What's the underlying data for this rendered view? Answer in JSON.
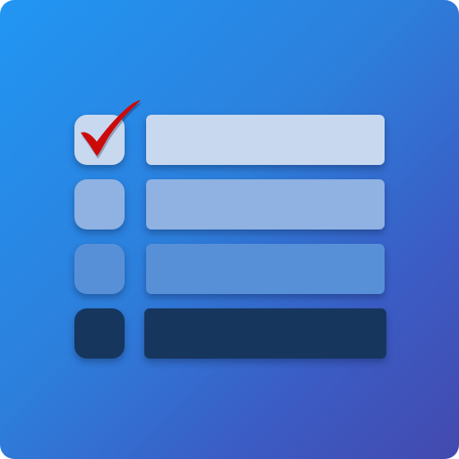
{
  "icon": {
    "name": "checklist-app-icon",
    "background_gradient": [
      "#2196f3",
      "#2d7fdc",
      "#3b5cc4",
      "#4349ae"
    ]
  },
  "checklist": {
    "rows": [
      {
        "checked": true,
        "box_color": "#c8d8ef",
        "bar_color": "#c8d8ef"
      },
      {
        "checked": false,
        "box_color": "#8fb2e2",
        "bar_color": "#8fb2e2"
      },
      {
        "checked": false,
        "box_color": "#5890d8",
        "bar_color": "#5890d8"
      },
      {
        "checked": false,
        "box_color": "#16365e",
        "bar_color": "#16365e"
      }
    ],
    "checkmark_color": "#cc0a0a"
  }
}
